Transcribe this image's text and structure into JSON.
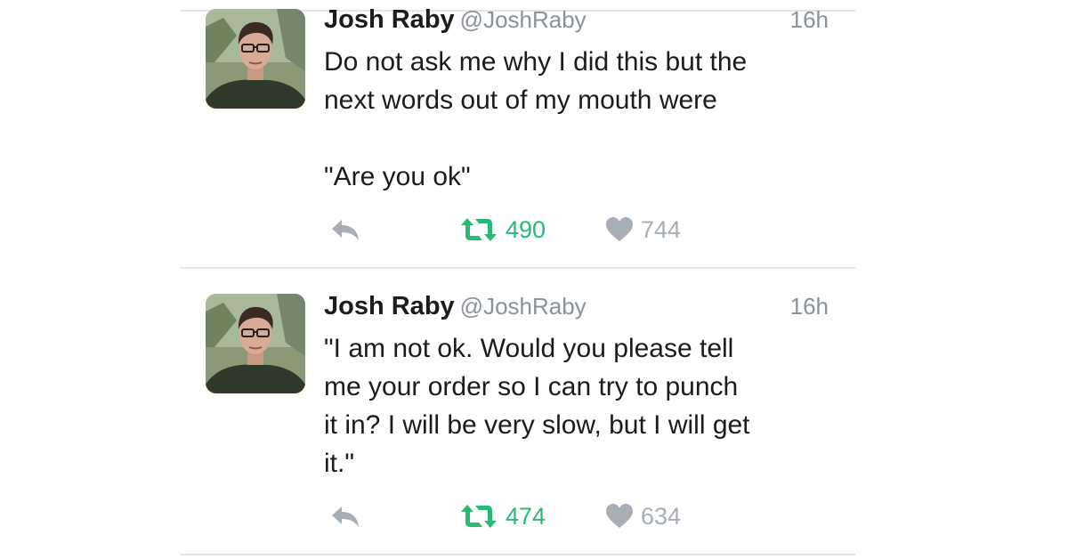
{
  "colors": {
    "retweet": "#27ba76",
    "icon_gray": "#a7aeb5",
    "meta_gray": "#8a9199",
    "divider": "#e2e5e8"
  },
  "tweets": [
    {
      "name": "Josh Raby",
      "handle": "@JoshRaby",
      "time": "16h",
      "text": "Do not ask me why I did this but the\nnext words out of my mouth were\n\n\"Are you ok\"",
      "retweets": "490",
      "likes": "744",
      "icons": [
        "reply-icon",
        "retweet-icon",
        "heart-icon"
      ]
    },
    {
      "name": "Josh Raby",
      "handle": "@JoshRaby",
      "time": "16h",
      "text": "\"I am not ok. Would you please tell\nme your order so I can try to punch\nit in? I will be very slow, but I will get\nit.\"",
      "retweets": "474",
      "likes": "634",
      "icons": [
        "reply-icon",
        "retweet-icon",
        "heart-icon"
      ]
    }
  ]
}
